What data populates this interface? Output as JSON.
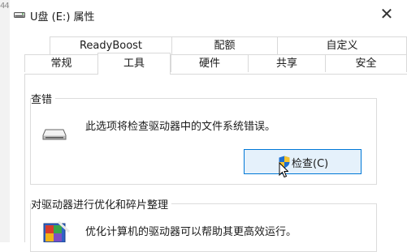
{
  "background_fragment": "44",
  "window": {
    "title": "U盘 (E:) 属性",
    "close_glyph": "✕"
  },
  "tabs": {
    "row1": [
      {
        "label": "ReadyBoost"
      },
      {
        "label": "配额"
      },
      {
        "label": "自定义"
      }
    ],
    "row2": [
      {
        "label": "常规"
      },
      {
        "label": "工具",
        "active": true
      },
      {
        "label": "硬件"
      },
      {
        "label": "共享"
      },
      {
        "label": "安全"
      }
    ]
  },
  "error_check": {
    "group_title": "查错",
    "description": "此选项将检查驱动器中的文件系统错误。",
    "button_label": "检查(C)",
    "button_icon": "uac-shield-icon"
  },
  "optimize": {
    "group_title": "对驱动器进行优化和碎片整理",
    "description": "优化计算机的驱动器可以帮助其更高效运行。"
  },
  "colors": {
    "button_bg": "#e5f1fb",
    "button_border": "#0078d7",
    "border": "#d9d9d9"
  }
}
